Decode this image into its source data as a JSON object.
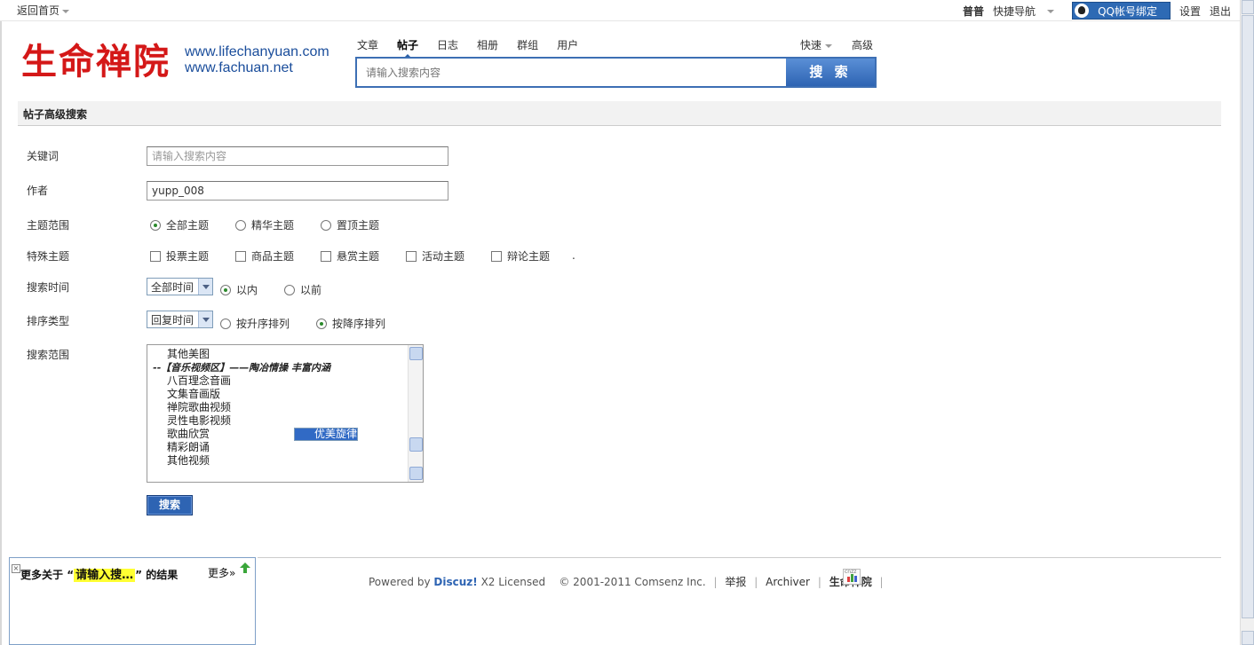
{
  "topbar": {
    "back_home": "返回首页",
    "username": "普普",
    "quick_nav": "快捷导航",
    "qq_bind": "QQ帐号绑定",
    "settings": "设置",
    "logout": "退出"
  },
  "logo": {
    "name": "生命禅院",
    "url1": "www.lifechanyuan.com",
    "url2": "www.fachuan.net"
  },
  "search_tabs": [
    "文章",
    "帖子",
    "日志",
    "相册",
    "群组",
    "用户"
  ],
  "search_tabs_active": "帖子",
  "quick": "快速",
  "advanced": "高级",
  "search": {
    "placeholder": "请输入搜索内容",
    "button": "搜 索"
  },
  "panel_title": "帖子高级搜索",
  "form": {
    "keyword_label": "关键词",
    "keyword_value": "请输入搜索内容",
    "author_label": "作者",
    "author_value": "yupp_008",
    "scope_label": "主题范围",
    "scope_options": [
      "全部主题",
      "精华主题",
      "置顶主题"
    ],
    "scope_selected": "全部主题",
    "special_label": "特殊主题",
    "special_options": [
      "投票主题",
      "商品主题",
      "悬赏主题",
      "活动主题",
      "辩论主题"
    ],
    "special_dot": ".",
    "time_label": "搜索时间",
    "time_select": "全部时间",
    "time_options": [
      "以内",
      "以前"
    ],
    "time_selected": "以内",
    "order_label": "排序类型",
    "order_select": "回复时间",
    "order_options": [
      "按升序排列",
      "按降序排列"
    ],
    "order_selected": "按降序排列",
    "range_label": "搜索范围",
    "forums": [
      {
        "label": "其他美图",
        "type": "item"
      },
      {
        "label": "--【音乐视频区】——陶冶情操 丰富内涵",
        "type": "cat"
      },
      {
        "label": "八百理念音画",
        "type": "item"
      },
      {
        "label": "文集音画版",
        "type": "item"
      },
      {
        "label": "禅院歌曲视频",
        "type": "item"
      },
      {
        "label": "灵性电影视频",
        "type": "item"
      },
      {
        "label": "优美旋律",
        "type": "selected"
      },
      {
        "label": "歌曲欣赏",
        "type": "item"
      },
      {
        "label": "精彩朗诵",
        "type": "item"
      },
      {
        "label": "其他视频",
        "type": "item"
      }
    ],
    "submit": "搜索"
  },
  "footer": {
    "powered_by": "Powered by",
    "discuz": "Discuz!",
    "version": "X2 Licensed",
    "copyright": "© 2001-2011 Comsenz Inc.",
    "report": "举报",
    "archiver": "Archiver",
    "site": "生命禅院",
    "cnzz": "cnzz"
  },
  "floatbox": {
    "prefix": "更多关于",
    "quote_open": "“",
    "keyword": "请输入搜…",
    "quote_close": "”",
    "suffix": "的结果",
    "more": "更多»"
  },
  "colors": {
    "accent": "#2e64b3",
    "logo_red": "#d41818",
    "highlight": "#ffff33"
  }
}
